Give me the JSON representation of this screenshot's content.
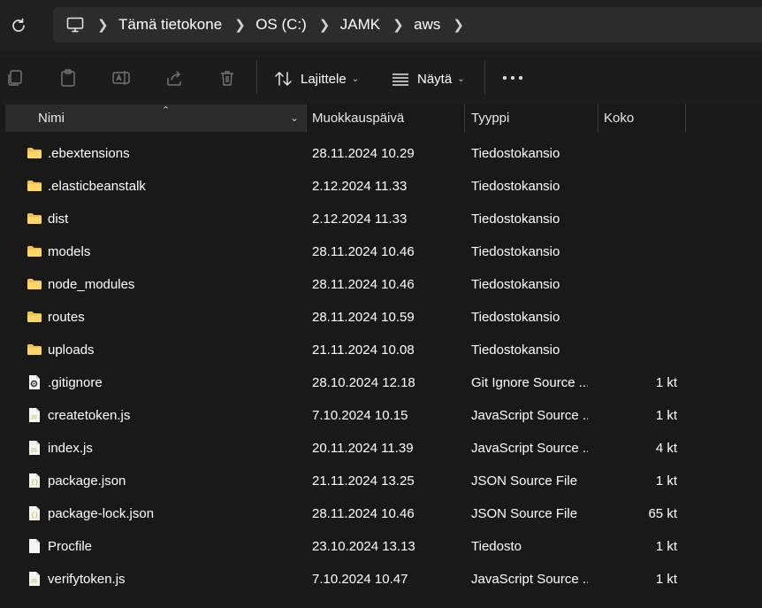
{
  "breadcrumb": [
    "Tämä tietokone",
    "OS (C:)",
    "JAMK",
    "aws"
  ],
  "toolbar": {
    "sort_label": "Lajittele",
    "view_label": "Näytä"
  },
  "columns": {
    "name": "Nimi",
    "modified": "Muokkauspäivä",
    "type": "Tyyppi",
    "size": "Koko"
  },
  "files": [
    {
      "icon": "folder-icon",
      "name": ".ebextensions",
      "modified": "28.11.2024 10.29",
      "type": "Tiedostokansio",
      "size": ""
    },
    {
      "icon": "folder-icon",
      "name": ".elasticbeanstalk",
      "modified": "2.12.2024 11.33",
      "type": "Tiedostokansio",
      "size": ""
    },
    {
      "icon": "folder-icon",
      "name": "dist",
      "modified": "2.12.2024 11.33",
      "type": "Tiedostokansio",
      "size": ""
    },
    {
      "icon": "folder-icon",
      "name": "models",
      "modified": "28.11.2024 10.46",
      "type": "Tiedostokansio",
      "size": ""
    },
    {
      "icon": "folder-icon",
      "name": "node_modules",
      "modified": "28.11.2024 10.46",
      "type": "Tiedostokansio",
      "size": ""
    },
    {
      "icon": "folder-icon",
      "name": "routes",
      "modified": "28.11.2024 10.59",
      "type": "Tiedostokansio",
      "size": ""
    },
    {
      "icon": "folder-icon",
      "name": "uploads",
      "modified": "21.11.2024 10.08",
      "type": "Tiedostokansio",
      "size": ""
    },
    {
      "icon": "gitignore-file-icon",
      "name": ".gitignore",
      "modified": "28.10.2024 12.18",
      "type": "Git Ignore Source ...",
      "size": "1 kt"
    },
    {
      "icon": "js-file-icon",
      "name": "createtoken.js",
      "modified": "7.10.2024 10.15",
      "type": "JavaScript Source ...",
      "size": "1 kt"
    },
    {
      "icon": "js-file-icon",
      "name": "index.js",
      "modified": "20.11.2024 11.39",
      "type": "JavaScript Source ...",
      "size": "4 kt"
    },
    {
      "icon": "json-file-icon",
      "name": "package.json",
      "modified": "21.11.2024 13.25",
      "type": "JSON Source File",
      "size": "1 kt"
    },
    {
      "icon": "json-file-icon",
      "name": "package-lock.json",
      "modified": "28.11.2024 10.46",
      "type": "JSON Source File",
      "size": "65 kt"
    },
    {
      "icon": "generic-file-icon",
      "name": "Procfile",
      "modified": "23.10.2024 13.13",
      "type": "Tiedosto",
      "size": "1 kt"
    },
    {
      "icon": "js-file-icon",
      "name": "verifytoken.js",
      "modified": "7.10.2024 10.47",
      "type": "JavaScript Source ...",
      "size": "1 kt"
    }
  ],
  "colors": {
    "background": "#191919",
    "folder": "#f2c14e",
    "js_icon": "#c7c75a",
    "json_icon": "#cfc35a"
  }
}
